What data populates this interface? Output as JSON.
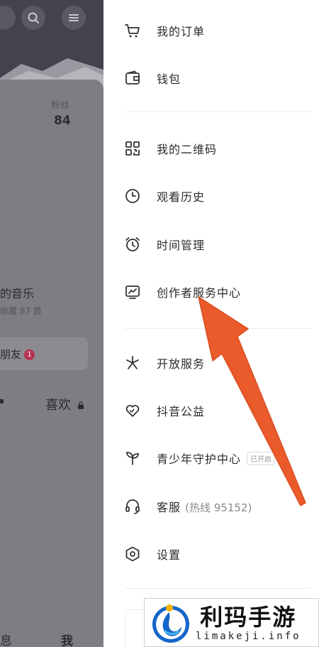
{
  "background": {
    "fans_label": "粉丝",
    "fans_count": "84",
    "music_title": "的音乐",
    "music_sub": "收藏 87 首",
    "friends_label": "朋友",
    "friends_badge": "1",
    "tab_likes": "喜欢",
    "nav_messages": "息",
    "nav_me": "我"
  },
  "menu": {
    "orders": "我的订单",
    "wallet": "钱包",
    "qrcode": "我的二维码",
    "history": "观看历史",
    "time": "时间管理",
    "creator": "创作者服务中心",
    "open": "开放服务",
    "charity": "抖音公益",
    "youth": "青少年守护中心",
    "youth_tag": "已开启",
    "service": "客服",
    "service_hotline": "(热线 95152)",
    "settings": "设置"
  },
  "watermark": {
    "title": "利玛手游",
    "url": "limakeji.info"
  },
  "colors": {
    "arrow": "#ea5a2a",
    "overlay": "#7d7c80",
    "text": "#2b2b30"
  }
}
